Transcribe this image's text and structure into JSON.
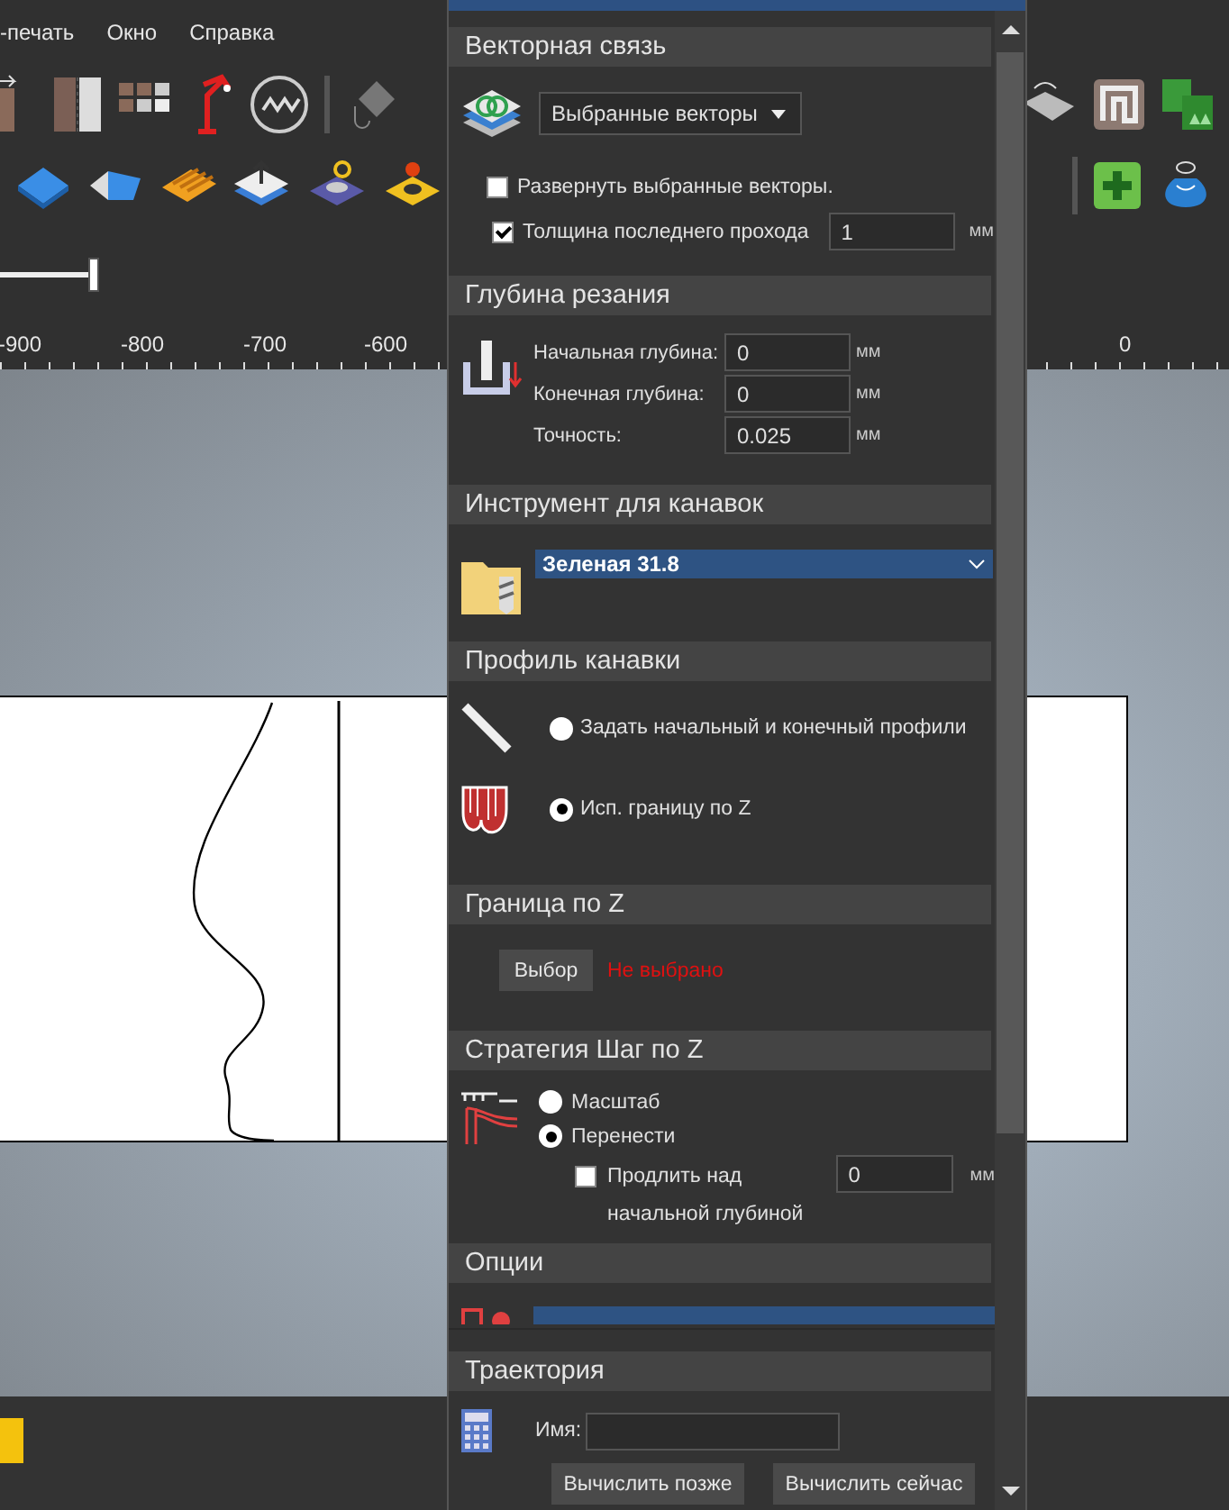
{
  "menu": [
    {
      "label": "-печать"
    },
    {
      "label": "Окно"
    },
    {
      "label": "Справка"
    }
  ],
  "slider": {
    "level": 1
  },
  "ruler": {
    "labels": [
      "-900",
      "-800",
      "-700",
      "-600",
      "0"
    ]
  },
  "panel": {
    "sections": [
      {
        "kind": "vector_link",
        "title": "Векторная связь",
        "dropdown": "Выбранные векторы",
        "options": [
          {
            "kind": "checkbox",
            "label": "Развернуть выбранные векторы.",
            "checked": false
          },
          {
            "kind": "checkbox_field",
            "label": "Толщина последнего прохода",
            "checked": true,
            "value": "1",
            "unit": "мм"
          }
        ]
      },
      {
        "kind": "fields",
        "title": "Глубина резания",
        "fields": [
          {
            "label": "Начальная глубина:",
            "value": "0",
            "unit": "мм"
          },
          {
            "label": "Конечная глубина:",
            "value": "0",
            "unit": "мм"
          },
          {
            "label": "Точность:",
            "value": "0.025",
            "unit": "мм"
          }
        ]
      },
      {
        "kind": "tool",
        "title": "Инструмент для канавок",
        "dropdown": "Зеленая 31.8"
      },
      {
        "kind": "radios",
        "title": "Профиль канавки",
        "options": [
          {
            "label": "Задать начальный и конечный профили",
            "selected": false
          },
          {
            "label": "Исп. границу по Z",
            "selected": true
          }
        ]
      },
      {
        "kind": "select",
        "title": "Граница по Z",
        "button": "Выбор",
        "status": "Не выбрано"
      },
      {
        "kind": "strategy",
        "title": "Стратегия Шаг по Z",
        "options": [
          {
            "label": "Масштаб",
            "selected": false
          },
          {
            "label": "Перенести",
            "selected": true
          }
        ],
        "extend": {
          "label": "Продлить над начальной глубиной",
          "checked": false,
          "value": "0",
          "unit": "мм"
        }
      },
      {
        "kind": "options",
        "title": "Опции"
      },
      {
        "kind": "toolpath",
        "title": "Траектория",
        "name_label": "Имя:",
        "buttons": [
          "Вычислить позже",
          "Вычислить сейчас"
        ]
      }
    ]
  }
}
